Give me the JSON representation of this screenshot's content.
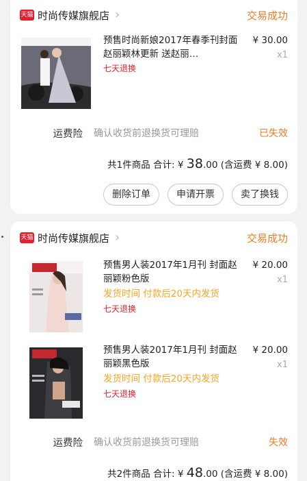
{
  "orders": [
    {
      "shop": "时尚传媒旗舰店",
      "tmall_badge": "天猫",
      "status": "交易成功",
      "items": [
        {
          "title": "预售时尚新娘2017年春季刊封面赵丽颖林更新 送赵丽…",
          "price": "¥ 30.00",
          "qty": "x1",
          "tag": "七天退换"
        }
      ],
      "shipping": {
        "label": "运费险",
        "desc": "确认收货前退换货可理赔",
        "state": "已失效"
      },
      "total": {
        "prefix": "共1件商品 合计: ¥ ",
        "amount": "38",
        "cents": ".00",
        "suffix": " (含运费 ¥ 8.00)"
      },
      "buttons": [
        "删除订单",
        "申请开票",
        "卖了换钱"
      ]
    },
    {
      "shop": "时尚传媒旗舰店",
      "tmall_badge": "天猫",
      "status": "交易成功",
      "items": [
        {
          "title": "预售男人装2017年1月刊 封面赵丽颖粉色版",
          "ship": "发货时间 付款后20天内发货",
          "price": "¥ 20.00",
          "qty": "x1",
          "tag": "七天退换"
        },
        {
          "title": "预售男人装2017年1月刊 封面赵丽颖黑色版",
          "ship": "发货时间 付款后20天内发货",
          "price": "¥ 20.00",
          "qty": "x1",
          "tag": "七天退换"
        }
      ],
      "shipping": {
        "label": "运费险",
        "desc": "确认收货前退换货可理赔",
        "state": "失效"
      },
      "total": {
        "prefix": "共2件商品 合计: ¥ ",
        "amount": "48",
        "cents": ".00",
        "suffix": " (含运费 ¥ 8.00)"
      }
    }
  ],
  "colors": {
    "accent": "#f07c27",
    "tag": "#e5202e",
    "ship": "#f5a623",
    "tmall": "#e5202e"
  },
  "icons": {
    "shop": "tmall-logo-icon",
    "chevron": "chevron-right-icon"
  }
}
